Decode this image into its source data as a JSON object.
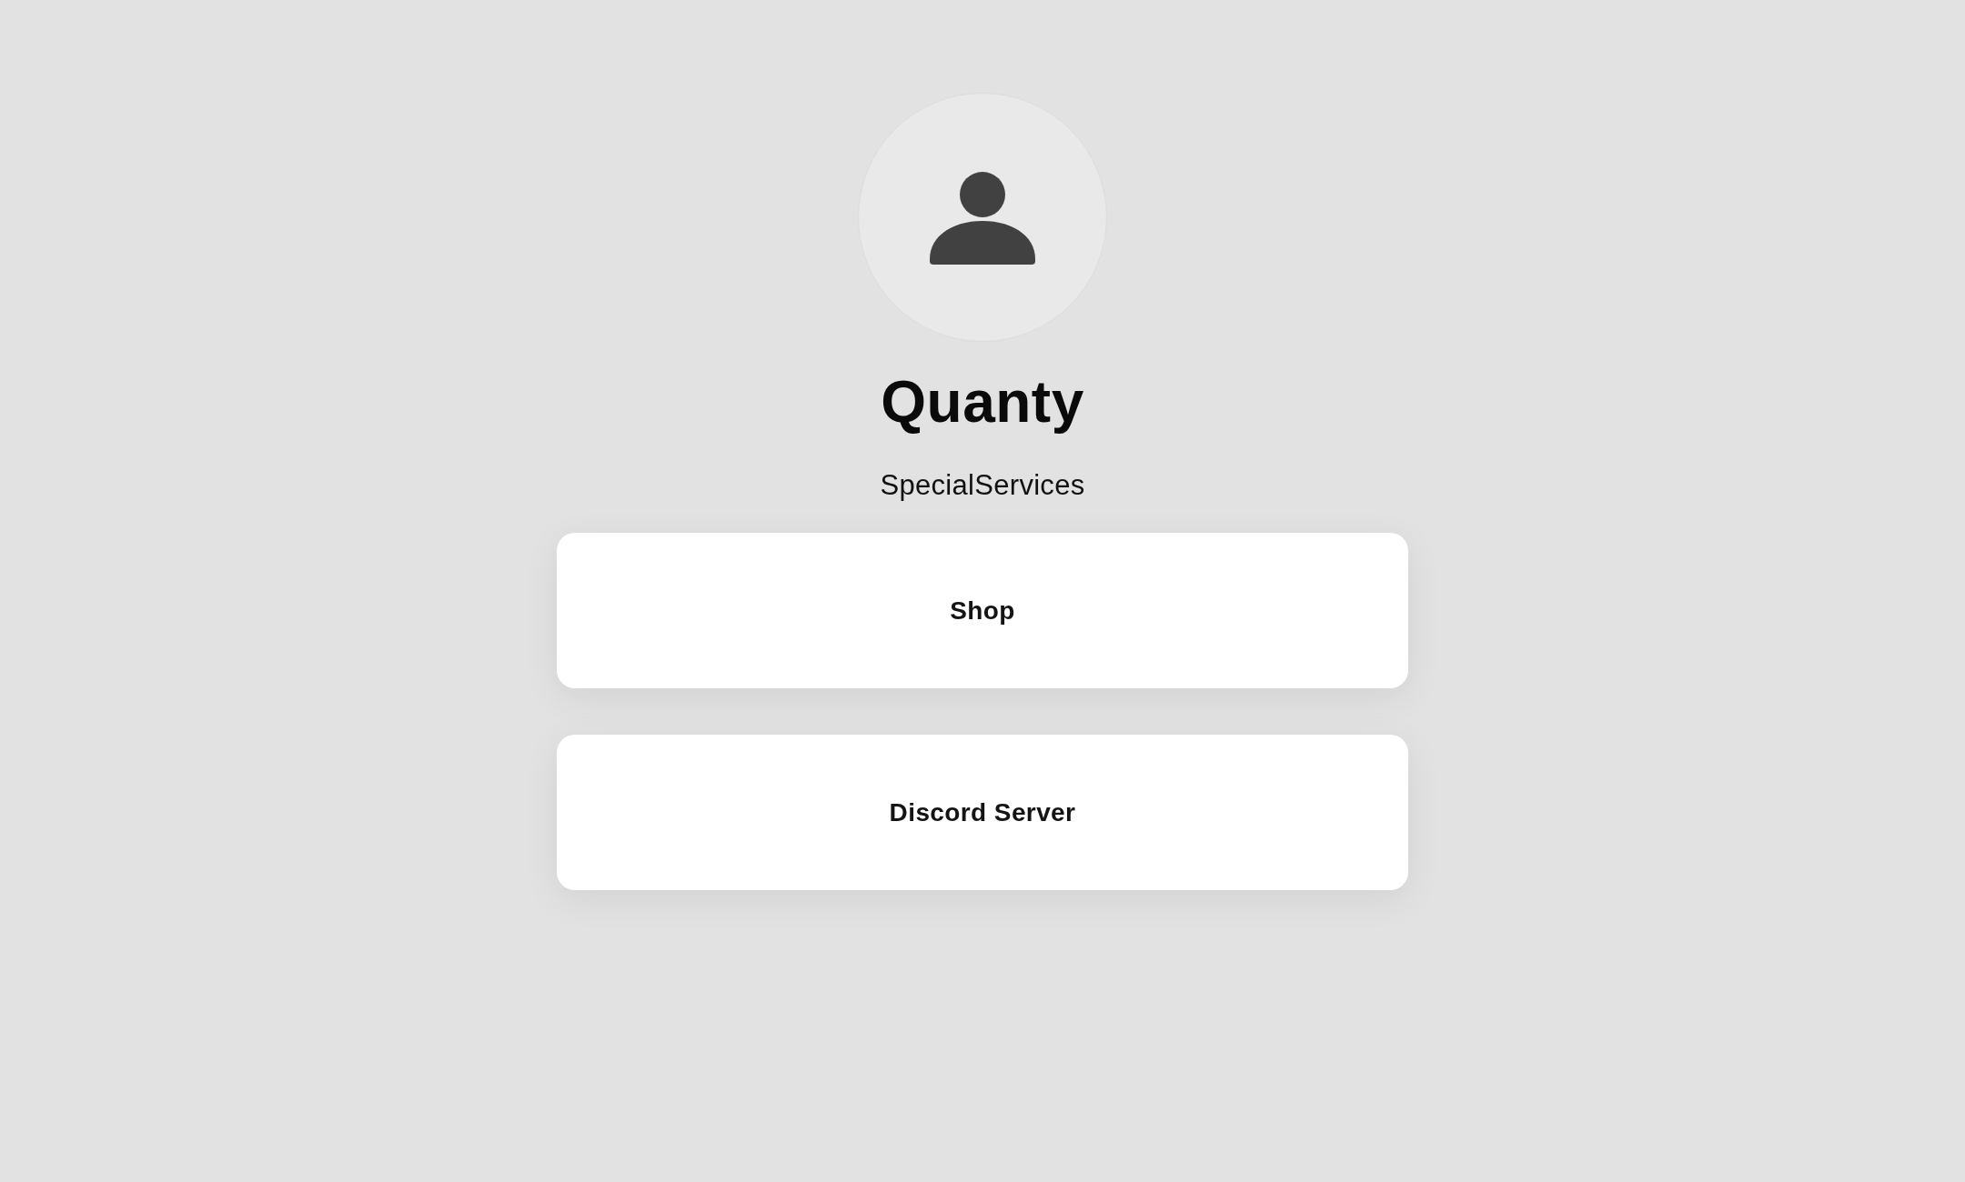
{
  "profile": {
    "name": "Quanty",
    "bio": "SpecialServices"
  },
  "links": [
    {
      "label": "Shop"
    },
    {
      "label": "Discord Server"
    }
  ]
}
